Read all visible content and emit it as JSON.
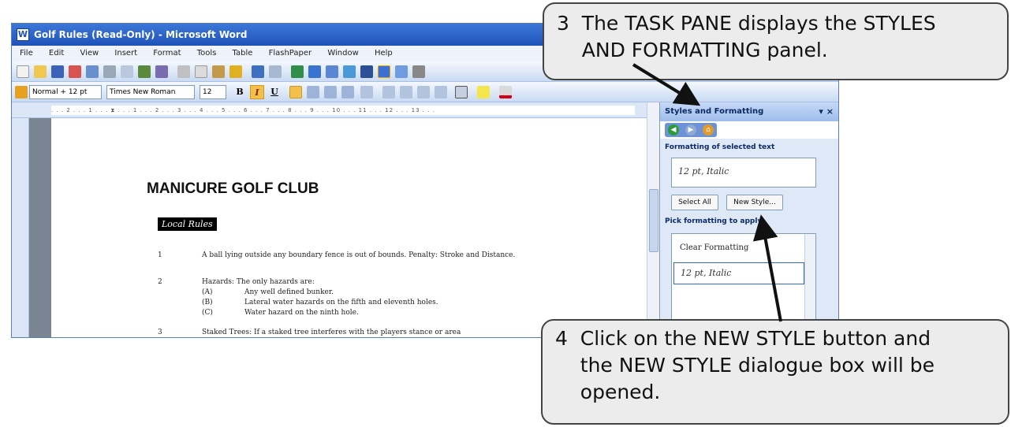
{
  "window": {
    "title": "Golf Rules (Read-Only) - Microsoft Word",
    "menu": [
      "File",
      "Edit",
      "View",
      "Insert",
      "Format",
      "Tools",
      "Table",
      "FlashPaper",
      "Window",
      "Help"
    ]
  },
  "formatting_toolbar": {
    "style": "Normal + 12 pt",
    "font": "Times New Roman",
    "size": "12",
    "bold": "B",
    "italic": "I",
    "underline": "U"
  },
  "document": {
    "heading": "MANICURE GOLF CLUB",
    "local_rules": "Local Rules",
    "rules": [
      {
        "num": "1",
        "text": "A ball lying outside any boundary fence is out of bounds.  Penalty: Stroke and Distance."
      },
      {
        "num": "2",
        "text": "Hazards:  The only hazards are:"
      },
      {
        "num": "3",
        "text": "Staked Trees:  If a staked tree interferes with the players stance or area"
      }
    ],
    "hazards": [
      {
        "label": "(A)",
        "text": "Any well defined bunker."
      },
      {
        "label": "(B)",
        "text": "Lateral water hazards on the fifth and eleventh holes."
      },
      {
        "label": "(C)",
        "text": "Water hazard on the ninth hole."
      }
    ]
  },
  "task_pane": {
    "title": "Styles and Formatting",
    "close": "▾ ×",
    "selected_heading": "Formatting of selected text",
    "selected_value": "12 pt, Italic",
    "select_all": "Select All",
    "new_style": "New Style...",
    "pick_heading": "Pick formatting to apply",
    "items": [
      "Clear Formatting",
      "12 pt, Italic"
    ]
  },
  "callouts": {
    "step3": "3  The TASK PANE displays the STYLES\n    AND FORMATTING panel.",
    "step4": "4  Click on the NEW STYLE button and\n    the NEW STYLE dialogue box will be\n    opened."
  }
}
